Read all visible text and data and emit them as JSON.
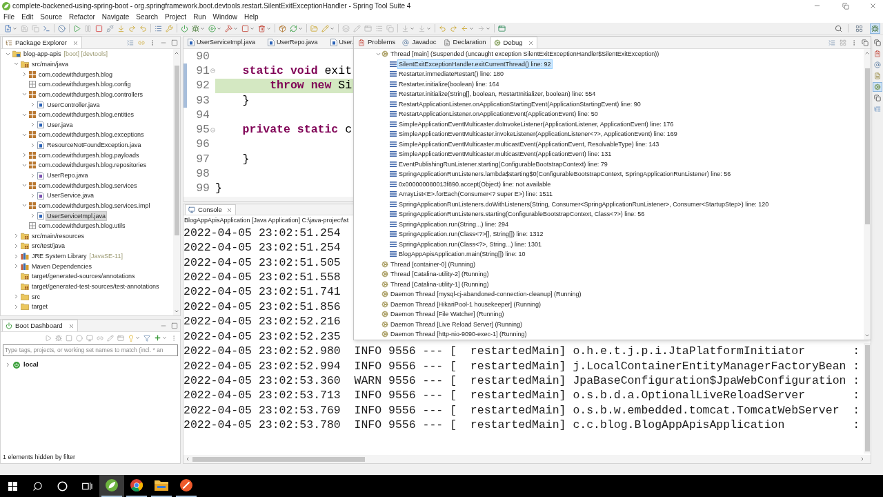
{
  "window": {
    "title": "complete-backened-using-spring-boot - org.springframework.boot.devtools.restart.SilentExitExceptionHandler - Spring Tool Suite 4"
  },
  "menu": [
    "File",
    "Edit",
    "Source",
    "Refactor",
    "Navigate",
    "Search",
    "Project",
    "Run",
    "Window",
    "Help"
  ],
  "perspectives": [
    {
      "kind": "open",
      "selected": false
    },
    {
      "kind": "debug",
      "selected": true
    }
  ],
  "package_explorer": {
    "title": "Package Explorer",
    "tree": [
      {
        "label": "blog-app-apis",
        "decoration": "[boot] [devtools]",
        "kind": "project",
        "expanded": true,
        "selected": false,
        "children": [
          {
            "label": "src/main/java",
            "kind": "source-folder",
            "expanded": true,
            "selected": false,
            "children": [
              {
                "label": "com.codewithdurgesh.blog",
                "kind": "package",
                "expanded": false,
                "selected": false
              },
              {
                "label": "com.codewithdurgesh.blog.config",
                "kind": "empty-package",
                "selected": false
              },
              {
                "label": "com.codewithdurgesh.blog.controllers",
                "kind": "package",
                "expanded": true,
                "selected": false,
                "children": [
                  {
                    "label": "UserController.java",
                    "kind": "class",
                    "expanded": false,
                    "selected": false
                  }
                ]
              },
              {
                "label": "com.codewithdurgesh.blog.entities",
                "kind": "package",
                "expanded": true,
                "selected": false,
                "children": [
                  {
                    "label": "User.java",
                    "kind": "class",
                    "expanded": false,
                    "selected": false
                  }
                ]
              },
              {
                "label": "com.codewithdurgesh.blog.exceptions",
                "kind": "package",
                "expanded": true,
                "selected": false,
                "children": [
                  {
                    "label": "ResourceNotFoundException.java",
                    "kind": "class",
                    "expanded": false,
                    "selected": false
                  }
                ]
              },
              {
                "label": "com.codewithdurgesh.blog.payloads",
                "kind": "package",
                "expanded": false,
                "selected": false
              },
              {
                "label": "com.codewithdurgesh.blog.repositories",
                "kind": "package",
                "expanded": true,
                "selected": false,
                "children": [
                  {
                    "label": "UserRepo.java",
                    "kind": "interface",
                    "expanded": false,
                    "selected": false
                  }
                ]
              },
              {
                "label": "com.codewithdurgesh.blog.services",
                "kind": "package",
                "expanded": true,
                "selected": false,
                "children": [
                  {
                    "label": "UserService.java",
                    "kind": "interface",
                    "expanded": false,
                    "selected": false
                  }
                ]
              },
              {
                "label": "com.codewithdurgesh.blog.services.impl",
                "kind": "package",
                "expanded": true,
                "selected": false,
                "children": [
                  {
                    "label": "UserServiceImpl.java",
                    "kind": "class",
                    "expanded": false,
                    "selected": true
                  }
                ]
              },
              {
                "label": "com.codewithdurgesh.blog.utils",
                "kind": "empty-package",
                "selected": false
              }
            ]
          },
          {
            "label": "src/main/resources",
            "kind": "source-folder",
            "expanded": false,
            "selected": false
          },
          {
            "label": "src/test/java",
            "kind": "source-folder",
            "expanded": false,
            "selected": false
          },
          {
            "label": "JRE System Library",
            "decoration": "[JavaSE-11]",
            "kind": "library",
            "expanded": false,
            "selected": false
          },
          {
            "label": "Maven Dependencies",
            "kind": "library",
            "expanded": false,
            "selected": false
          },
          {
            "label": "target/generated-sources/annotations",
            "kind": "source-folder",
            "selected": false
          },
          {
            "label": "target/generated-test-sources/test-annotations",
            "kind": "source-folder",
            "selected": false
          },
          {
            "label": "src",
            "kind": "folder",
            "expanded": false,
            "selected": false
          },
          {
            "label": "target",
            "kind": "folder",
            "expanded": false,
            "selected": false
          }
        ]
      }
    ]
  },
  "boot_dashboard": {
    "title": "Boot Dashboard",
    "filter": {
      "placeholder": "Type tags, projects, or working set names to match (incl. * an"
    },
    "tree": [
      {
        "label": "local",
        "expanded": false,
        "selected": false
      }
    ],
    "footer": "1 elements hidden by filter"
  },
  "editor": {
    "tabs": [
      "UserServiceImpl.java",
      "UserRepo.java",
      "User."
    ],
    "lines": [
      {
        "number": "90",
        "foldable": false,
        "current": false,
        "in_range": false
      },
      {
        "number": "91",
        "code": "    **static** **void** exit",
        "foldable": true,
        "current": false,
        "in_range": true
      },
      {
        "number": "92",
        "code": "        **throw** **new** Si",
        "foldable": false,
        "current": true,
        "in_range": true
      },
      {
        "number": "93",
        "code": "    }",
        "foldable": false,
        "current": false,
        "in_range": true
      },
      {
        "number": "94",
        "foldable": false,
        "current": false,
        "in_range": false
      },
      {
        "number": "95",
        "code": "    **private** **static** c",
        "foldable": true,
        "current": false,
        "in_range": false
      },
      {
        "number": "96",
        "foldable": false,
        "current": false,
        "in_range": false
      },
      {
        "number": "97",
        "code": "    }",
        "foldable": false,
        "current": false,
        "in_range": false
      },
      {
        "number": "98",
        "foldable": false,
        "current": false,
        "in_range": false
      },
      {
        "number": "99",
        "code": "}",
        "foldable": false,
        "current": false,
        "in_range": false
      }
    ]
  },
  "console": {
    "title": "Console",
    "process": "BlogAppApisApplication [Java Application] C:\\java-project\\st",
    "rows": [
      {
        "timestamp": "2022-04-05 23:02:51.254"
      },
      {
        "timestamp": "2022-04-05 23:02:51.254"
      },
      {
        "timestamp": "2022-04-05 23:02:51.505"
      },
      {
        "timestamp": "2022-04-05 23:02:51.558"
      },
      {
        "timestamp": "2022-04-05 23:02:51.741"
      },
      {
        "timestamp": "2022-04-05 23:02:51.856"
      },
      {
        "timestamp": "2022-04-05 23:02:52.216"
      },
      {
        "timestamp": "2022-04-05 23:02:52.235"
      },
      {
        "timestamp": "2022-04-05 23:02:52.980",
        "message": "INFO 9556 --- [  restartedMain] o.h.e.t.j.p.i.JtaPlatformInitiator       :"
      },
      {
        "timestamp": "2022-04-05 23:02:52.994",
        "message": "INFO 9556 --- [  restartedMain] j.LocalContainerEntityManagerFactoryBean :"
      },
      {
        "timestamp": "2022-04-05 23:02:53.360",
        "message": "WARN 9556 --- [  restartedMain] JpaBaseConfiguration$JpaWebConfiguration :"
      },
      {
        "timestamp": "2022-04-05 23:02:53.713",
        "message": "INFO 9556 --- [  restartedMain] o.s.b.d.a.OptionalLiveReloadServer       :"
      },
      {
        "timestamp": "2022-04-05 23:02:53.769",
        "message": "INFO 9556 --- [  restartedMain] o.s.b.w.embedded.tomcat.TomcatWebServer  :"
      },
      {
        "timestamp": "2022-04-05 23:02:53.780",
        "message": "INFO 9556 --- [  restartedMain] c.c.blog.BlogAppApisApplication          :"
      }
    ]
  },
  "debug": {
    "tabs": [
      {
        "label": "Problems",
        "kind": "problems",
        "selected": false
      },
      {
        "label": "Javadoc",
        "kind": "javadoc",
        "selected": false
      },
      {
        "label": "Declaration",
        "kind": "declaration",
        "selected": false
      },
      {
        "label": "Debug",
        "kind": "debug",
        "selected": true
      }
    ],
    "tree": [
      {
        "label": "Thread [main] (Suspended (uncaught exception SilentExitExceptionHandler$SilentExitException))",
        "expanded": true,
        "selected": false,
        "children": [
          {
            "label": "SilentExitExceptionHandler.exitCurrentThread() line: 92",
            "selected": true
          },
          {
            "label": "Restarter.immediateRestart() line: 180",
            "selected": false
          },
          {
            "label": "Restarter.initialize(boolean) line: 164",
            "selected": false
          },
          {
            "label": "Restarter.initialize(String[], boolean, RestartInitializer, boolean) line: 554",
            "selected": false
          },
          {
            "label": "RestartApplicationListener.onApplicationStartingEvent(ApplicationStartingEvent) line: 90",
            "selected": false
          },
          {
            "label": "RestartApplicationListener.onApplicationEvent(ApplicationEvent) line: 50",
            "selected": false
          },
          {
            "label": "SimpleApplicationEventMulticaster.doInvokeListener(ApplicationListener, ApplicationEvent) line: 176",
            "selected": false
          },
          {
            "label": "SimpleApplicationEventMulticaster.invokeListener(ApplicationListener<?>, ApplicationEvent) line: 169",
            "selected": false
          },
          {
            "label": "SimpleApplicationEventMulticaster.multicastEvent(ApplicationEvent, ResolvableType) line: 143",
            "selected": false
          },
          {
            "label": "SimpleApplicationEventMulticaster.multicastEvent(ApplicationEvent) line: 131",
            "selected": false
          },
          {
            "label": "EventPublishingRunListener.starting(ConfigurableBootstrapContext) line: 79",
            "selected": false
          },
          {
            "label": "SpringApplicationRunListeners.lambda$starting$0(ConfigurableBootstrapContext, SpringApplicationRunListener) line: 56",
            "selected": false
          },
          {
            "label": "0x000000080013f890.accept(Object) line: not available",
            "selected": false
          },
          {
            "label": "ArrayList<E>.forEach(Consumer<? super E>) line: 1511",
            "selected": false
          },
          {
            "label": "SpringApplicationRunListeners.doWithListeners(String, Consumer<SpringApplicationRunListener>, Consumer<StartupStep>) line: 120",
            "selected": false
          },
          {
            "label": "SpringApplicationRunListeners.starting(ConfigurableBootstrapContext, Class<?>) line: 56",
            "selected": false
          },
          {
            "label": "SpringApplication.run(String...) line: 294",
            "selected": false
          },
          {
            "label": "SpringApplication.run(Class<?>[], String[]) line: 1312",
            "selected": false
          },
          {
            "label": "SpringApplication.run(Class<?>, String...) line: 1301",
            "selected": false
          },
          {
            "label": "BlogAppApisApplication.main(String[]) line: 10",
            "selected": false
          }
        ]
      },
      {
        "label": "Thread [container-0] (Running)",
        "selected": false
      },
      {
        "label": "Thread [Catalina-utility-2] (Running)",
        "selected": false
      },
      {
        "label": "Thread [Catalina-utility-1] (Running)",
        "selected": false
      },
      {
        "label": "Daemon Thread [mysql-cj-abandoned-connection-cleanup] (Running)",
        "selected": false
      },
      {
        "label": "Daemon Thread [HikariPool-1 housekeeper] (Running)",
        "selected": false
      },
      {
        "label": "Daemon Thread [File Watcher] (Running)",
        "selected": false
      },
      {
        "label": "Daemon Thread [Live Reload Server] (Running)",
        "selected": false
      },
      {
        "label": "Daemon Thread [http-nio-9090-exec-1] (Running)",
        "selected": false
      }
    ]
  },
  "trim": [
    {
      "kind": "restore",
      "selected": false
    },
    {
      "kind": "problems",
      "selected": false
    },
    {
      "kind": "javadoc",
      "selected": false
    },
    {
      "kind": "declaration",
      "selected": false
    },
    {
      "kind": "debug",
      "selected": true
    },
    {
      "kind": "restore",
      "selected": false
    },
    {
      "kind": "outline",
      "selected": false
    }
  ],
  "taskbar": {
    "apps": [
      {
        "kind": "leaf",
        "running": true,
        "selected": true
      },
      {
        "kind": "browser",
        "running": true,
        "selected": false
      },
      {
        "kind": "folder",
        "running": true,
        "selected": false
      },
      {
        "kind": "pen",
        "running": true,
        "selected": false
      }
    ]
  }
}
